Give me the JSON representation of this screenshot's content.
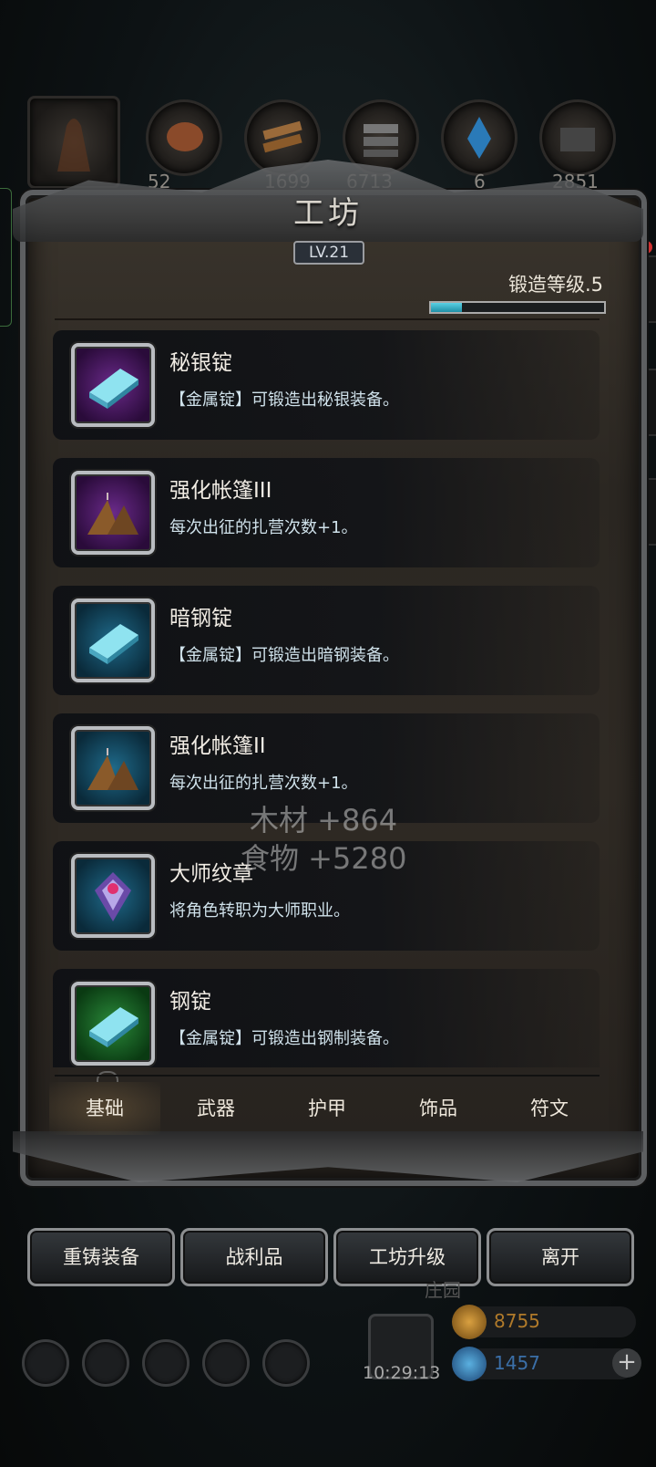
{
  "top_resources": [
    {
      "icon": "cloak-icon",
      "value": ""
    },
    {
      "icon": "meat-icon",
      "value": "52"
    },
    {
      "icon": "wood-planks-icon",
      "value": "1699"
    },
    {
      "icon": "iron-bars-icon",
      "value": "6713"
    },
    {
      "icon": "crystal-icon",
      "value": "6"
    },
    {
      "icon": "stone-icon",
      "value": "2851"
    }
  ],
  "panel": {
    "title": "工坊",
    "level": "LV.21",
    "forge_level_label": "锻造等级.5",
    "forge_progress": 0.18
  },
  "items": [
    {
      "name": "秘银锭",
      "desc": "【金属锭】可锻造出秘银装备。",
      "icon": "mithril-ingot-icon",
      "rarity": "purple"
    },
    {
      "name": "强化帐篷III",
      "desc": "每次出征的扎营次数+1。",
      "icon": "tent-icon",
      "rarity": "purple"
    },
    {
      "name": "暗钢锭",
      "desc": "【金属锭】可锻造出暗钢装备。",
      "icon": "dark-steel-ingot-icon",
      "rarity": "blue"
    },
    {
      "name": "强化帐篷II",
      "desc": "每次出征的扎营次数+1。",
      "icon": "tent-icon",
      "rarity": "blue"
    },
    {
      "name": "大师纹章",
      "desc": "将角色转职为大师职业。",
      "icon": "master-emblem-icon",
      "rarity": "blue"
    },
    {
      "name": "钢锭",
      "desc": "【金属锭】可锻造出钢制装备。",
      "icon": "steel-ingot-icon",
      "rarity": "green"
    }
  ],
  "floating": {
    "line1": "木材 +864",
    "line2": "食物 +5280"
  },
  "tabs": [
    "基础",
    "武器",
    "护甲",
    "饰品",
    "符文"
  ],
  "active_tab": "基础",
  "buttons": {
    "recast": "重铸装备",
    "loot": "战利品",
    "upgrade": "工坊升级",
    "leave": "离开"
  },
  "footer": {
    "clock": "10:29:13",
    "faded_label": "庄园",
    "gold": "8755",
    "gems": "1457",
    "plus": "+"
  },
  "colors": {
    "accent_cyan": "#3fb8d0",
    "gold_text": "#b07a2a",
    "gem_text": "#3b6fa8"
  }
}
